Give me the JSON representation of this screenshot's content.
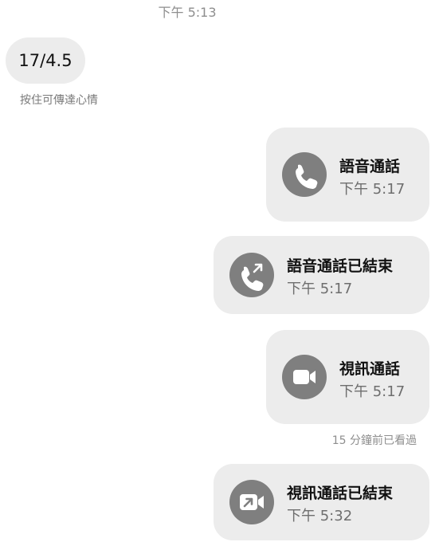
{
  "header_time": "下午 5:13",
  "incoming": {
    "text": "17/4.5",
    "hint": "按住可傳達心情"
  },
  "calls": [
    {
      "title": "語音通話",
      "time": "下午 5:17",
      "icon": "phone-icon"
    },
    {
      "title": "語音通話已結束",
      "time": "下午 5:17",
      "icon": "phone-outgoing-icon"
    },
    {
      "title": "視訊通話",
      "time": "下午 5:17",
      "icon": "video-camera-icon"
    },
    {
      "title": "視訊通話已結束",
      "time": "下午 5:32",
      "icon": "video-outgoing-icon"
    }
  ],
  "seen_status": "15 分鐘前已看過",
  "colors": {
    "bubble": "#ececec",
    "icon_circle": "#7f7f7f",
    "muted_text": "#8e8e8e"
  }
}
